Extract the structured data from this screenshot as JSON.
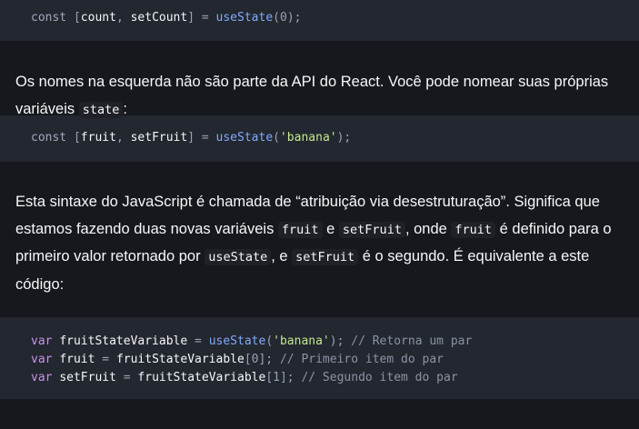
{
  "code1": {
    "line": {
      "kw": "const",
      "open": "[",
      "v1": "count",
      "comma": ",",
      "v2": "setCount",
      "close": "]",
      "eq": "=",
      "fn": "useState",
      "lp": "(",
      "arg": "0",
      "rp": ");"
    }
  },
  "para1": {
    "text_before": "Os nomes na esquerda não são parte da API do React. Você pode nomear suas próprias variáveis ",
    "code": "state",
    "text_after": ":"
  },
  "code2": {
    "line": {
      "kw": "const",
      "open": "[",
      "v1": "fruit",
      "comma": ",",
      "v2": "setFruit",
      "close": "]",
      "eq": "=",
      "fn": "useState",
      "lp": "(",
      "arg": "'banana'",
      "rp": ");"
    }
  },
  "para2": {
    "t1": "Esta sintaxe do JavaScript é chamada de ",
    "t1_link": "“atribuição via desestruturação”",
    "t2": ". Significa que estamos fazendo duas novas variáveis ",
    "c1": "fruit",
    "t3": " e ",
    "c2": "setFruit",
    "t4": ", onde ",
    "c3": "fruit",
    "t5": " é definido para o primeiro valor retornado por ",
    "c4": "useState",
    "t6": ", e ",
    "c5": "setFruit",
    "t7": " é o segundo. É equivalente a este código:"
  },
  "code3": {
    "lines": [
      {
        "kw": "var",
        "name": "fruitStateVariable",
        "eq": "=",
        "fn": "useState",
        "lp": "(",
        "arg": "'banana'",
        "rp": ");",
        "comment": "// Retorna um par"
      },
      {
        "kw": "var",
        "name": "fruit",
        "eq": "=",
        "rhs": "fruitStateVariable",
        "lb": "[",
        "idx": "0",
        "rb": "];",
        "comment": "// Primeiro item do par"
      },
      {
        "kw": "var",
        "name": "setFruit",
        "eq": "=",
        "rhs": "fruitStateVariable",
        "lb": "[",
        "idx": "1",
        "rb": "];",
        "comment": "// Segundo item do par"
      }
    ]
  }
}
